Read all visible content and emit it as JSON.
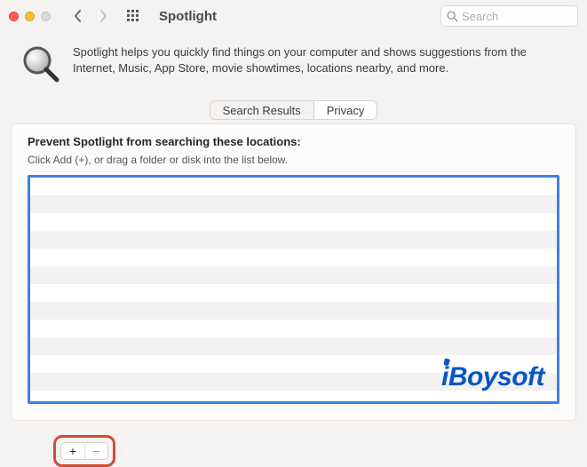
{
  "window": {
    "title": "Spotlight",
    "search_placeholder": "Search"
  },
  "header": {
    "description": "Spotlight helps you quickly find things on your computer and shows suggestions from the Internet, Music, App Store, movie showtimes, locations nearby, and more."
  },
  "tabs": {
    "search_results": "Search Results",
    "privacy": "Privacy",
    "active": "privacy"
  },
  "privacy": {
    "title": "Prevent Spotlight from searching these locations:",
    "subtitle": "Click Add (+), or drag a folder or disk into the list below.",
    "items": []
  },
  "buttons": {
    "add": "+",
    "remove": "−"
  },
  "watermark": "iBoysoft"
}
